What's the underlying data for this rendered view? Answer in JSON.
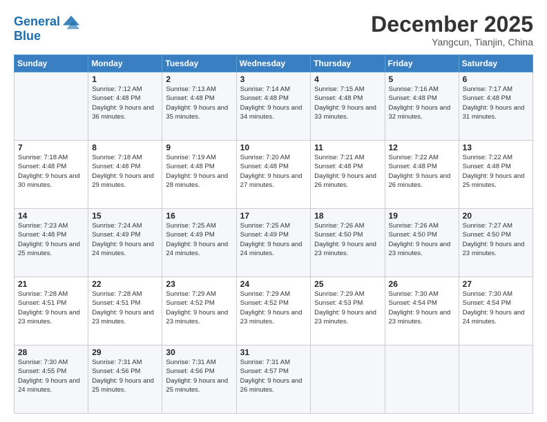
{
  "header": {
    "logo_line1": "General",
    "logo_line2": "Blue",
    "month": "December 2025",
    "location": "Yangcun, Tianjin, China"
  },
  "days_of_week": [
    "Sunday",
    "Monday",
    "Tuesday",
    "Wednesday",
    "Thursday",
    "Friday",
    "Saturday"
  ],
  "weeks": [
    [
      {
        "day": "",
        "sunrise": "",
        "sunset": "",
        "daylight": ""
      },
      {
        "day": "1",
        "sunrise": "Sunrise: 7:12 AM",
        "sunset": "Sunset: 4:48 PM",
        "daylight": "Daylight: 9 hours and 36 minutes."
      },
      {
        "day": "2",
        "sunrise": "Sunrise: 7:13 AM",
        "sunset": "Sunset: 4:48 PM",
        "daylight": "Daylight: 9 hours and 35 minutes."
      },
      {
        "day": "3",
        "sunrise": "Sunrise: 7:14 AM",
        "sunset": "Sunset: 4:48 PM",
        "daylight": "Daylight: 9 hours and 34 minutes."
      },
      {
        "day": "4",
        "sunrise": "Sunrise: 7:15 AM",
        "sunset": "Sunset: 4:48 PM",
        "daylight": "Daylight: 9 hours and 33 minutes."
      },
      {
        "day": "5",
        "sunrise": "Sunrise: 7:16 AM",
        "sunset": "Sunset: 4:48 PM",
        "daylight": "Daylight: 9 hours and 32 minutes."
      },
      {
        "day": "6",
        "sunrise": "Sunrise: 7:17 AM",
        "sunset": "Sunset: 4:48 PM",
        "daylight": "Daylight: 9 hours and 31 minutes."
      }
    ],
    [
      {
        "day": "7",
        "sunrise": "Sunrise: 7:18 AM",
        "sunset": "Sunset: 4:48 PM",
        "daylight": "Daylight: 9 hours and 30 minutes."
      },
      {
        "day": "8",
        "sunrise": "Sunrise: 7:18 AM",
        "sunset": "Sunset: 4:48 PM",
        "daylight": "Daylight: 9 hours and 29 minutes."
      },
      {
        "day": "9",
        "sunrise": "Sunrise: 7:19 AM",
        "sunset": "Sunset: 4:48 PM",
        "daylight": "Daylight: 9 hours and 28 minutes."
      },
      {
        "day": "10",
        "sunrise": "Sunrise: 7:20 AM",
        "sunset": "Sunset: 4:48 PM",
        "daylight": "Daylight: 9 hours and 27 minutes."
      },
      {
        "day": "11",
        "sunrise": "Sunrise: 7:21 AM",
        "sunset": "Sunset: 4:48 PM",
        "daylight": "Daylight: 9 hours and 26 minutes."
      },
      {
        "day": "12",
        "sunrise": "Sunrise: 7:22 AM",
        "sunset": "Sunset: 4:48 PM",
        "daylight": "Daylight: 9 hours and 26 minutes."
      },
      {
        "day": "13",
        "sunrise": "Sunrise: 7:22 AM",
        "sunset": "Sunset: 4:48 PM",
        "daylight": "Daylight: 9 hours and 25 minutes."
      }
    ],
    [
      {
        "day": "14",
        "sunrise": "Sunrise: 7:23 AM",
        "sunset": "Sunset: 4:48 PM",
        "daylight": "Daylight: 9 hours and 25 minutes."
      },
      {
        "day": "15",
        "sunrise": "Sunrise: 7:24 AM",
        "sunset": "Sunset: 4:49 PM",
        "daylight": "Daylight: 9 hours and 24 minutes."
      },
      {
        "day": "16",
        "sunrise": "Sunrise: 7:25 AM",
        "sunset": "Sunset: 4:49 PM",
        "daylight": "Daylight: 9 hours and 24 minutes."
      },
      {
        "day": "17",
        "sunrise": "Sunrise: 7:25 AM",
        "sunset": "Sunset: 4:49 PM",
        "daylight": "Daylight: 9 hours and 24 minutes."
      },
      {
        "day": "18",
        "sunrise": "Sunrise: 7:26 AM",
        "sunset": "Sunset: 4:50 PM",
        "daylight": "Daylight: 9 hours and 23 minutes."
      },
      {
        "day": "19",
        "sunrise": "Sunrise: 7:26 AM",
        "sunset": "Sunset: 4:50 PM",
        "daylight": "Daylight: 9 hours and 23 minutes."
      },
      {
        "day": "20",
        "sunrise": "Sunrise: 7:27 AM",
        "sunset": "Sunset: 4:50 PM",
        "daylight": "Daylight: 9 hours and 23 minutes."
      }
    ],
    [
      {
        "day": "21",
        "sunrise": "Sunrise: 7:28 AM",
        "sunset": "Sunset: 4:51 PM",
        "daylight": "Daylight: 9 hours and 23 minutes."
      },
      {
        "day": "22",
        "sunrise": "Sunrise: 7:28 AM",
        "sunset": "Sunset: 4:51 PM",
        "daylight": "Daylight: 9 hours and 23 minutes."
      },
      {
        "day": "23",
        "sunrise": "Sunrise: 7:29 AM",
        "sunset": "Sunset: 4:52 PM",
        "daylight": "Daylight: 9 hours and 23 minutes."
      },
      {
        "day": "24",
        "sunrise": "Sunrise: 7:29 AM",
        "sunset": "Sunset: 4:52 PM",
        "daylight": "Daylight: 9 hours and 23 minutes."
      },
      {
        "day": "25",
        "sunrise": "Sunrise: 7:29 AM",
        "sunset": "Sunset: 4:53 PM",
        "daylight": "Daylight: 9 hours and 23 minutes."
      },
      {
        "day": "26",
        "sunrise": "Sunrise: 7:30 AM",
        "sunset": "Sunset: 4:54 PM",
        "daylight": "Daylight: 9 hours and 23 minutes."
      },
      {
        "day": "27",
        "sunrise": "Sunrise: 7:30 AM",
        "sunset": "Sunset: 4:54 PM",
        "daylight": "Daylight: 9 hours and 24 minutes."
      }
    ],
    [
      {
        "day": "28",
        "sunrise": "Sunrise: 7:30 AM",
        "sunset": "Sunset: 4:55 PM",
        "daylight": "Daylight: 9 hours and 24 minutes."
      },
      {
        "day": "29",
        "sunrise": "Sunrise: 7:31 AM",
        "sunset": "Sunset: 4:56 PM",
        "daylight": "Daylight: 9 hours and 25 minutes."
      },
      {
        "day": "30",
        "sunrise": "Sunrise: 7:31 AM",
        "sunset": "Sunset: 4:56 PM",
        "daylight": "Daylight: 9 hours and 25 minutes."
      },
      {
        "day": "31",
        "sunrise": "Sunrise: 7:31 AM",
        "sunset": "Sunset: 4:57 PM",
        "daylight": "Daylight: 9 hours and 26 minutes."
      },
      {
        "day": "",
        "sunrise": "",
        "sunset": "",
        "daylight": ""
      },
      {
        "day": "",
        "sunrise": "",
        "sunset": "",
        "daylight": ""
      },
      {
        "day": "",
        "sunrise": "",
        "sunset": "",
        "daylight": ""
      }
    ]
  ]
}
